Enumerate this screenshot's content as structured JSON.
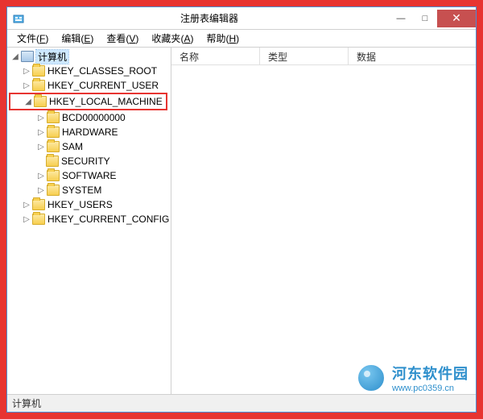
{
  "titlebar": {
    "title": "注册表编辑器"
  },
  "win_buttons": {
    "min": "—",
    "max": "□",
    "close": "✕"
  },
  "menu": {
    "file": {
      "t": "文件",
      "k": "F"
    },
    "edit": {
      "t": "编辑",
      "k": "E"
    },
    "view": {
      "t": "查看",
      "k": "V"
    },
    "fav": {
      "t": "收藏夹",
      "k": "A"
    },
    "help": {
      "t": "帮助",
      "k": "H"
    }
  },
  "columns": {
    "name": "名称",
    "type": "类型",
    "data": "数据"
  },
  "tree": {
    "root": "计算机",
    "n0": "HKEY_CLASSES_ROOT",
    "n1": "HKEY_CURRENT_USER",
    "n2": "HKEY_LOCAL_MACHINE",
    "n2_0": "BCD00000000",
    "n2_1": "HARDWARE",
    "n2_2": "SAM",
    "n2_3": "SECURITY",
    "n2_4": "SOFTWARE",
    "n2_5": "SYSTEM",
    "n3": "HKEY_USERS",
    "n4": "HKEY_CURRENT_CONFIG"
  },
  "statusbar": "计算机",
  "watermark": {
    "cn": "河东软件园",
    "url": "www.pc0359.cn"
  },
  "expander": {
    "expanded": "◢",
    "collapsed": "▷"
  }
}
